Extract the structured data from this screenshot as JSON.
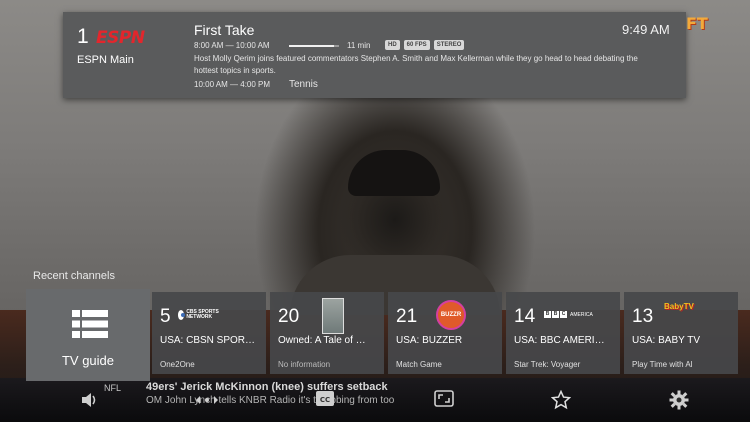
{
  "info_card": {
    "channel_number": "1",
    "channel_logo": "ESPN",
    "channel_name": "ESPN Main",
    "program_title": "First Take",
    "program_time": "8:00 AM — 10:00 AM",
    "progress_fraction": 0.9,
    "remaining": "11 min",
    "badges": [
      "HD",
      "60 FPS",
      "STEREO"
    ],
    "description": "Host Molly Qerim joins featured commentators Stephen A. Smith and Max Kellerman while they go head to head debating the hottest topics in sports.",
    "next_time": "10:00 AM — 4:00 PM",
    "next_title": "Tennis",
    "clock": "9:49 AM",
    "brand_logo": "FT"
  },
  "recent": {
    "label": "Recent channels",
    "tv_guide_label": "TV guide",
    "channels": [
      {
        "number": "5",
        "name": "USA: CBSN SPOR…",
        "program": "One2One",
        "logo": "CBS SPORTS NETWORK",
        "icon": "cbs-sports-logo"
      },
      {
        "number": "20",
        "name": "Owned: A Tale of …",
        "program": "No information",
        "logo": "",
        "icon": "poster-logo"
      },
      {
        "number": "21",
        "name": "USA: BUZZER",
        "program": "Match Game",
        "logo": "BUZZR",
        "icon": "buzzr-logo"
      },
      {
        "number": "14",
        "name": "USA: BBC AMERI…",
        "program": "Star Trek: Voyager",
        "logo": "BBC AMERICA",
        "icon": "bbc-america-logo"
      },
      {
        "number": "13",
        "name": "USA: BABY TV",
        "program": "Play Time with Al",
        "logo": "BabyTV",
        "icon": "babytv-logo"
      }
    ]
  },
  "ticker": {
    "league": "NFL",
    "headline": "49ers' Jerick McKinnon (knee) suffers setback",
    "sub": "OM John Lynch tells KNBR Radio it's throbbing from too"
  },
  "toolbar": {
    "icons": [
      "volume-icon",
      "audio-track-icon",
      "closed-captions-icon",
      "aspect-ratio-icon",
      "favorite-star-icon",
      "settings-gear-icon"
    ]
  }
}
